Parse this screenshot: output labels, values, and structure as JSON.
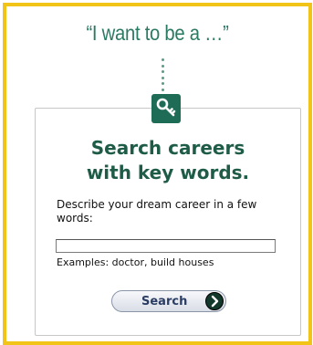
{
  "header": {
    "tagline": "“I want to be a …”"
  },
  "icons": {
    "key": "key-icon",
    "go": "arrow-right-icon"
  },
  "search_panel": {
    "headline_line1": "Search careers",
    "headline_line2": "with key words.",
    "prompt": "Describe your dream career in a few words:",
    "input_value": "",
    "input_placeholder": "",
    "examples": "Examples: doctor, build houses",
    "button_label": "Search"
  },
  "colors": {
    "frame_border": "#f2c418",
    "accent_green": "#1e6b56",
    "headline_green": "#1e5c48",
    "button_text": "#2a3c63"
  }
}
